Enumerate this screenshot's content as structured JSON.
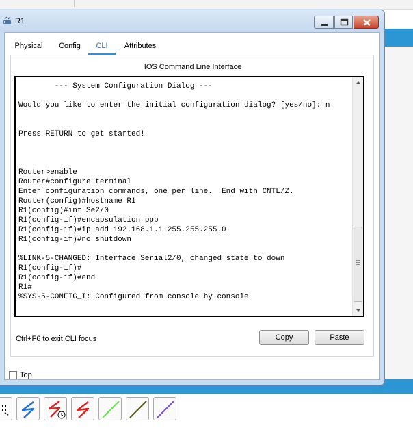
{
  "window": {
    "title": "R1",
    "icon": "router-icon"
  },
  "tabs": [
    {
      "label": "Physical"
    },
    {
      "label": "Config"
    },
    {
      "label": "CLI",
      "active": true
    },
    {
      "label": "Attributes"
    }
  ],
  "cli": {
    "header": "IOS Command Line Interface",
    "lines": [
      "        --- System Configuration Dialog ---",
      "",
      "Would you like to enter the initial configuration dialog? [yes/no]: n",
      "",
      "",
      "Press RETURN to get started!",
      "",
      "",
      "",
      "Router>enable",
      "Router#configure terminal",
      "Enter configuration commands, one per line.  End with CNTL/Z.",
      "Router(config)#hostname R1",
      "R1(config)#int Se2/0",
      "R1(config-if)#encapsulation ppp",
      "R1(config-if)#ip add 192.168.1.1 255.255.255.0",
      "R1(config-if)#no shutdown",
      "",
      "%LINK-5-CHANGED: Interface Serial2/0, changed state to down",
      "R1(config-if)#",
      "R1(config-if)#end",
      "R1#",
      "%SYS-5-CONFIG_I: Configured from console by console"
    ],
    "exit_hint": "Ctrl+F6 to exit CLI focus",
    "copy_label": "Copy",
    "paste_label": "Paste"
  },
  "top_checkbox": {
    "label": "Top",
    "checked": false
  },
  "connections_toolbar": [
    {
      "icon": "automatic-connection-icon",
      "color": "#000000"
    },
    {
      "icon": "console-cable-icon",
      "color": "#1e6fd9"
    },
    {
      "icon": "serial-dce-icon",
      "color": "#e0201c"
    },
    {
      "icon": "serial-dte-icon",
      "color": "#e0201c"
    },
    {
      "icon": "straight-through-cable-icon",
      "color": "#6ee05a"
    },
    {
      "icon": "crossover-cable-icon",
      "color": "#5a5a1a"
    },
    {
      "icon": "fiber-cable-icon",
      "color": "#7a52c8"
    }
  ],
  "colors": {
    "accent_tab": "#2f8fd6",
    "background_blue": "#2c95d4",
    "window_frame": "#c8dcf2"
  }
}
